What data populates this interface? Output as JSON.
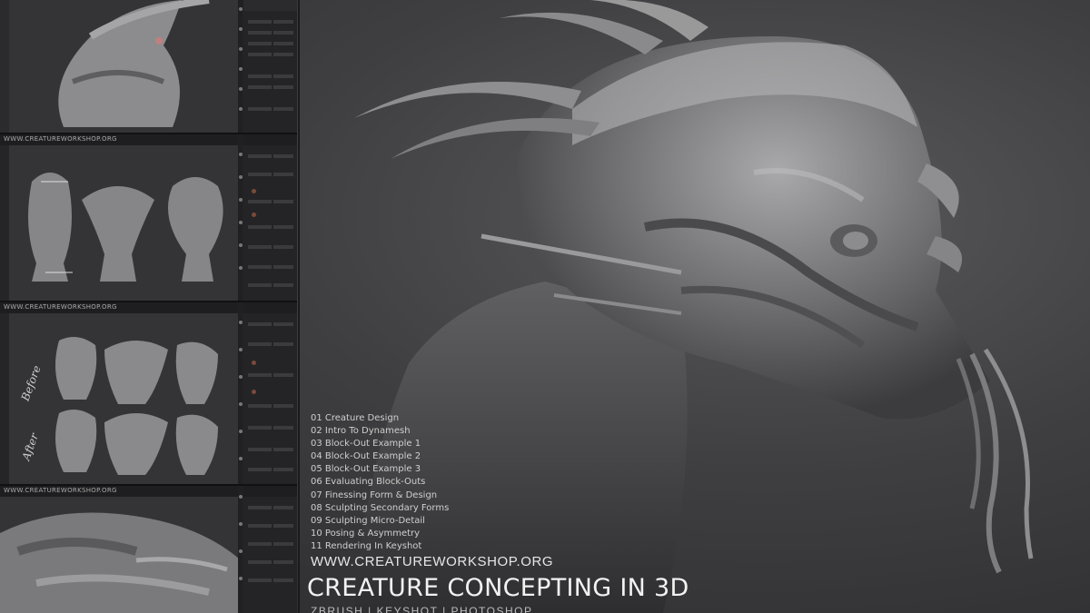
{
  "panels": [
    {
      "url": "",
      "notes": []
    },
    {
      "url": "WWW.CREATUREWORKSHOP.ORG",
      "notes": []
    },
    {
      "url": "WWW.CREATUREWORKSHOP.ORG",
      "notes": [
        "Before",
        "After"
      ]
    },
    {
      "url": "WWW.CREATUREWORKSHOP.ORG",
      "notes": []
    }
  ],
  "chapters": [
    "01 Creature Design",
    "02 Intro To Dynamesh",
    "03 Block-Out Example 1",
    "04 Block-Out Example 2",
    "05 Block-Out Example 3",
    "06 Evaluating Block-Outs",
    "07 Finessing Form & Design",
    "08 Sculpting Secondary Forms",
    "09 Sculpting Micro-Detail",
    "10 Posing & Asymmetry",
    "11 Rendering In Keyshot"
  ],
  "site_url": "WWW.CREATUREWORKSHOP.ORG",
  "course_title": "CREATURE CONCEPTING IN 3D",
  "tools_line": "ZBRUSH | KEYSHOT | PHOTOSHOP",
  "colors": {
    "background": "#3a3a3c",
    "sculpt": "#9a9a9c",
    "text": "#e6e6e6"
  }
}
